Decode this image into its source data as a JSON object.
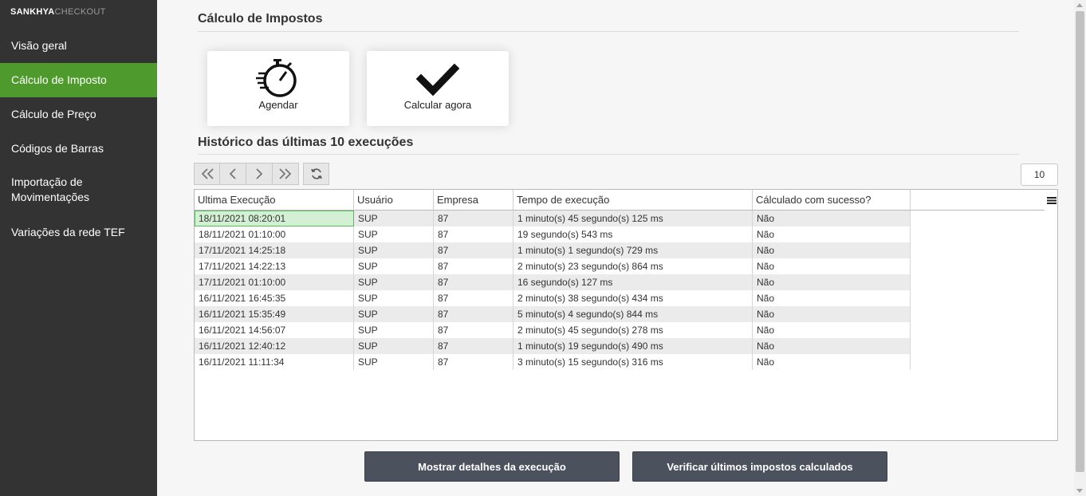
{
  "brand": {
    "part1": "SANKHYA",
    "part2": "CHECKOUT"
  },
  "sidebar": {
    "items": [
      {
        "label": "Visão geral"
      },
      {
        "label": "Cálculo de Imposto"
      },
      {
        "label": "Cálculo de Preço"
      },
      {
        "label": "Códigos de Barras"
      },
      {
        "label": "Importação de Movimentações"
      },
      {
        "label": "Variações da rede TEF"
      }
    ]
  },
  "page": {
    "title": "Cálculo de Impostos",
    "history_title": "Histórico das últimas 10 execuções"
  },
  "actions": {
    "schedule": {
      "label": "Agendar",
      "icon": "stopwatch-icon"
    },
    "calculate": {
      "label": "Calcular agora",
      "icon": "checkmark-icon"
    }
  },
  "pager": {
    "page_size": "10"
  },
  "grid": {
    "columns": [
      "Ultima Execução",
      "Usuário",
      "Empresa",
      "Tempo de execução",
      "Cálculado com sucesso?"
    ],
    "rows": [
      [
        "18/11/2021 08:20:01",
        "SUP",
        "87",
        "1 minuto(s) 45 segundo(s) 125 ms",
        "Não"
      ],
      [
        "18/11/2021 01:10:00",
        "SUP",
        "87",
        "19 segundo(s) 543 ms",
        "Não"
      ],
      [
        "17/11/2021 14:25:18",
        "SUP",
        "87",
        "1 minuto(s) 1 segundo(s) 729 ms",
        "Não"
      ],
      [
        "17/11/2021 14:22:13",
        "SUP",
        "87",
        "2 minuto(s) 23 segundo(s) 864 ms",
        "Não"
      ],
      [
        "17/11/2021 01:10:00",
        "SUP",
        "87",
        "16 segundo(s) 127 ms",
        "Não"
      ],
      [
        "16/11/2021 16:45:35",
        "SUP",
        "87",
        "2 minuto(s) 38 segundo(s) 434 ms",
        "Não"
      ],
      [
        "16/11/2021 15:35:49",
        "SUP",
        "87",
        "5 minuto(s) 4 segundo(s) 844 ms",
        "Não"
      ],
      [
        "16/11/2021 14:56:07",
        "SUP",
        "87",
        "2 minuto(s) 45 segundo(s) 278 ms",
        "Não"
      ],
      [
        "16/11/2021 12:40:12",
        "SUP",
        "87",
        "1 minuto(s) 19 segundo(s) 490 ms",
        "Não"
      ],
      [
        "16/11/2021 11:11:34",
        "SUP",
        "87",
        "3 minuto(s) 15 segundo(s) 316 ms",
        "Não"
      ]
    ]
  },
  "buttons": {
    "details": "Mostrar detalhes da execução",
    "verify": "Verificar últimos impostos calculados"
  },
  "colors": {
    "sidebar": "#333333",
    "active": "#4e9a2d",
    "button": "#4b525d"
  }
}
